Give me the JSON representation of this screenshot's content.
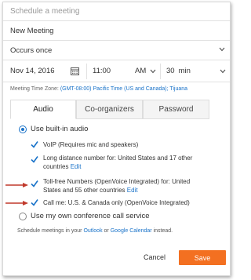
{
  "dialog": {
    "title": "Schedule a meeting",
    "meeting_name": "New Meeting",
    "occurs": "Occurs once",
    "date": "Nov 14, 2016",
    "time": "11:00",
    "ampm": "AM",
    "duration_value": "30",
    "duration_unit": "min",
    "timezone_label": "Meeting Time Zone:",
    "timezone_value": "(GMT-08:00) Pacific Time (US and Canada); Tijuana"
  },
  "tabs": [
    {
      "label": "Audio",
      "active": true
    },
    {
      "label": "Co-organizers",
      "active": false
    },
    {
      "label": "Password",
      "active": false
    }
  ],
  "audio": {
    "builtin_label": "Use built-in audio",
    "own_service_label": "Use my own conference call service",
    "options": [
      {
        "text": "VoIP (Requires mic and speakers)",
        "edit": ""
      },
      {
        "text_line1": "Long distance number for: United States and 17 other",
        "text_line2": "countries",
        "edit": "Edit"
      },
      {
        "text_line1": "Toll-free Numbers (OpenVoice Integrated) for: United",
        "text_line2": "States and 55 other countries",
        "edit": "Edit"
      },
      {
        "text": "Call me: U.S. & Canada only (OpenVoice Integrated)",
        "edit": ""
      }
    ]
  },
  "footer": {
    "note_prefix": "Schedule meetings in your",
    "outlook": "Outlook",
    "or": "or",
    "gcal": "Google Calendar",
    "note_suffix": "instead.",
    "cancel": "Cancel",
    "save": "Save"
  },
  "colors": {
    "accent": "#f37021",
    "link": "#1a73c9",
    "arrow": "#c0392b"
  }
}
